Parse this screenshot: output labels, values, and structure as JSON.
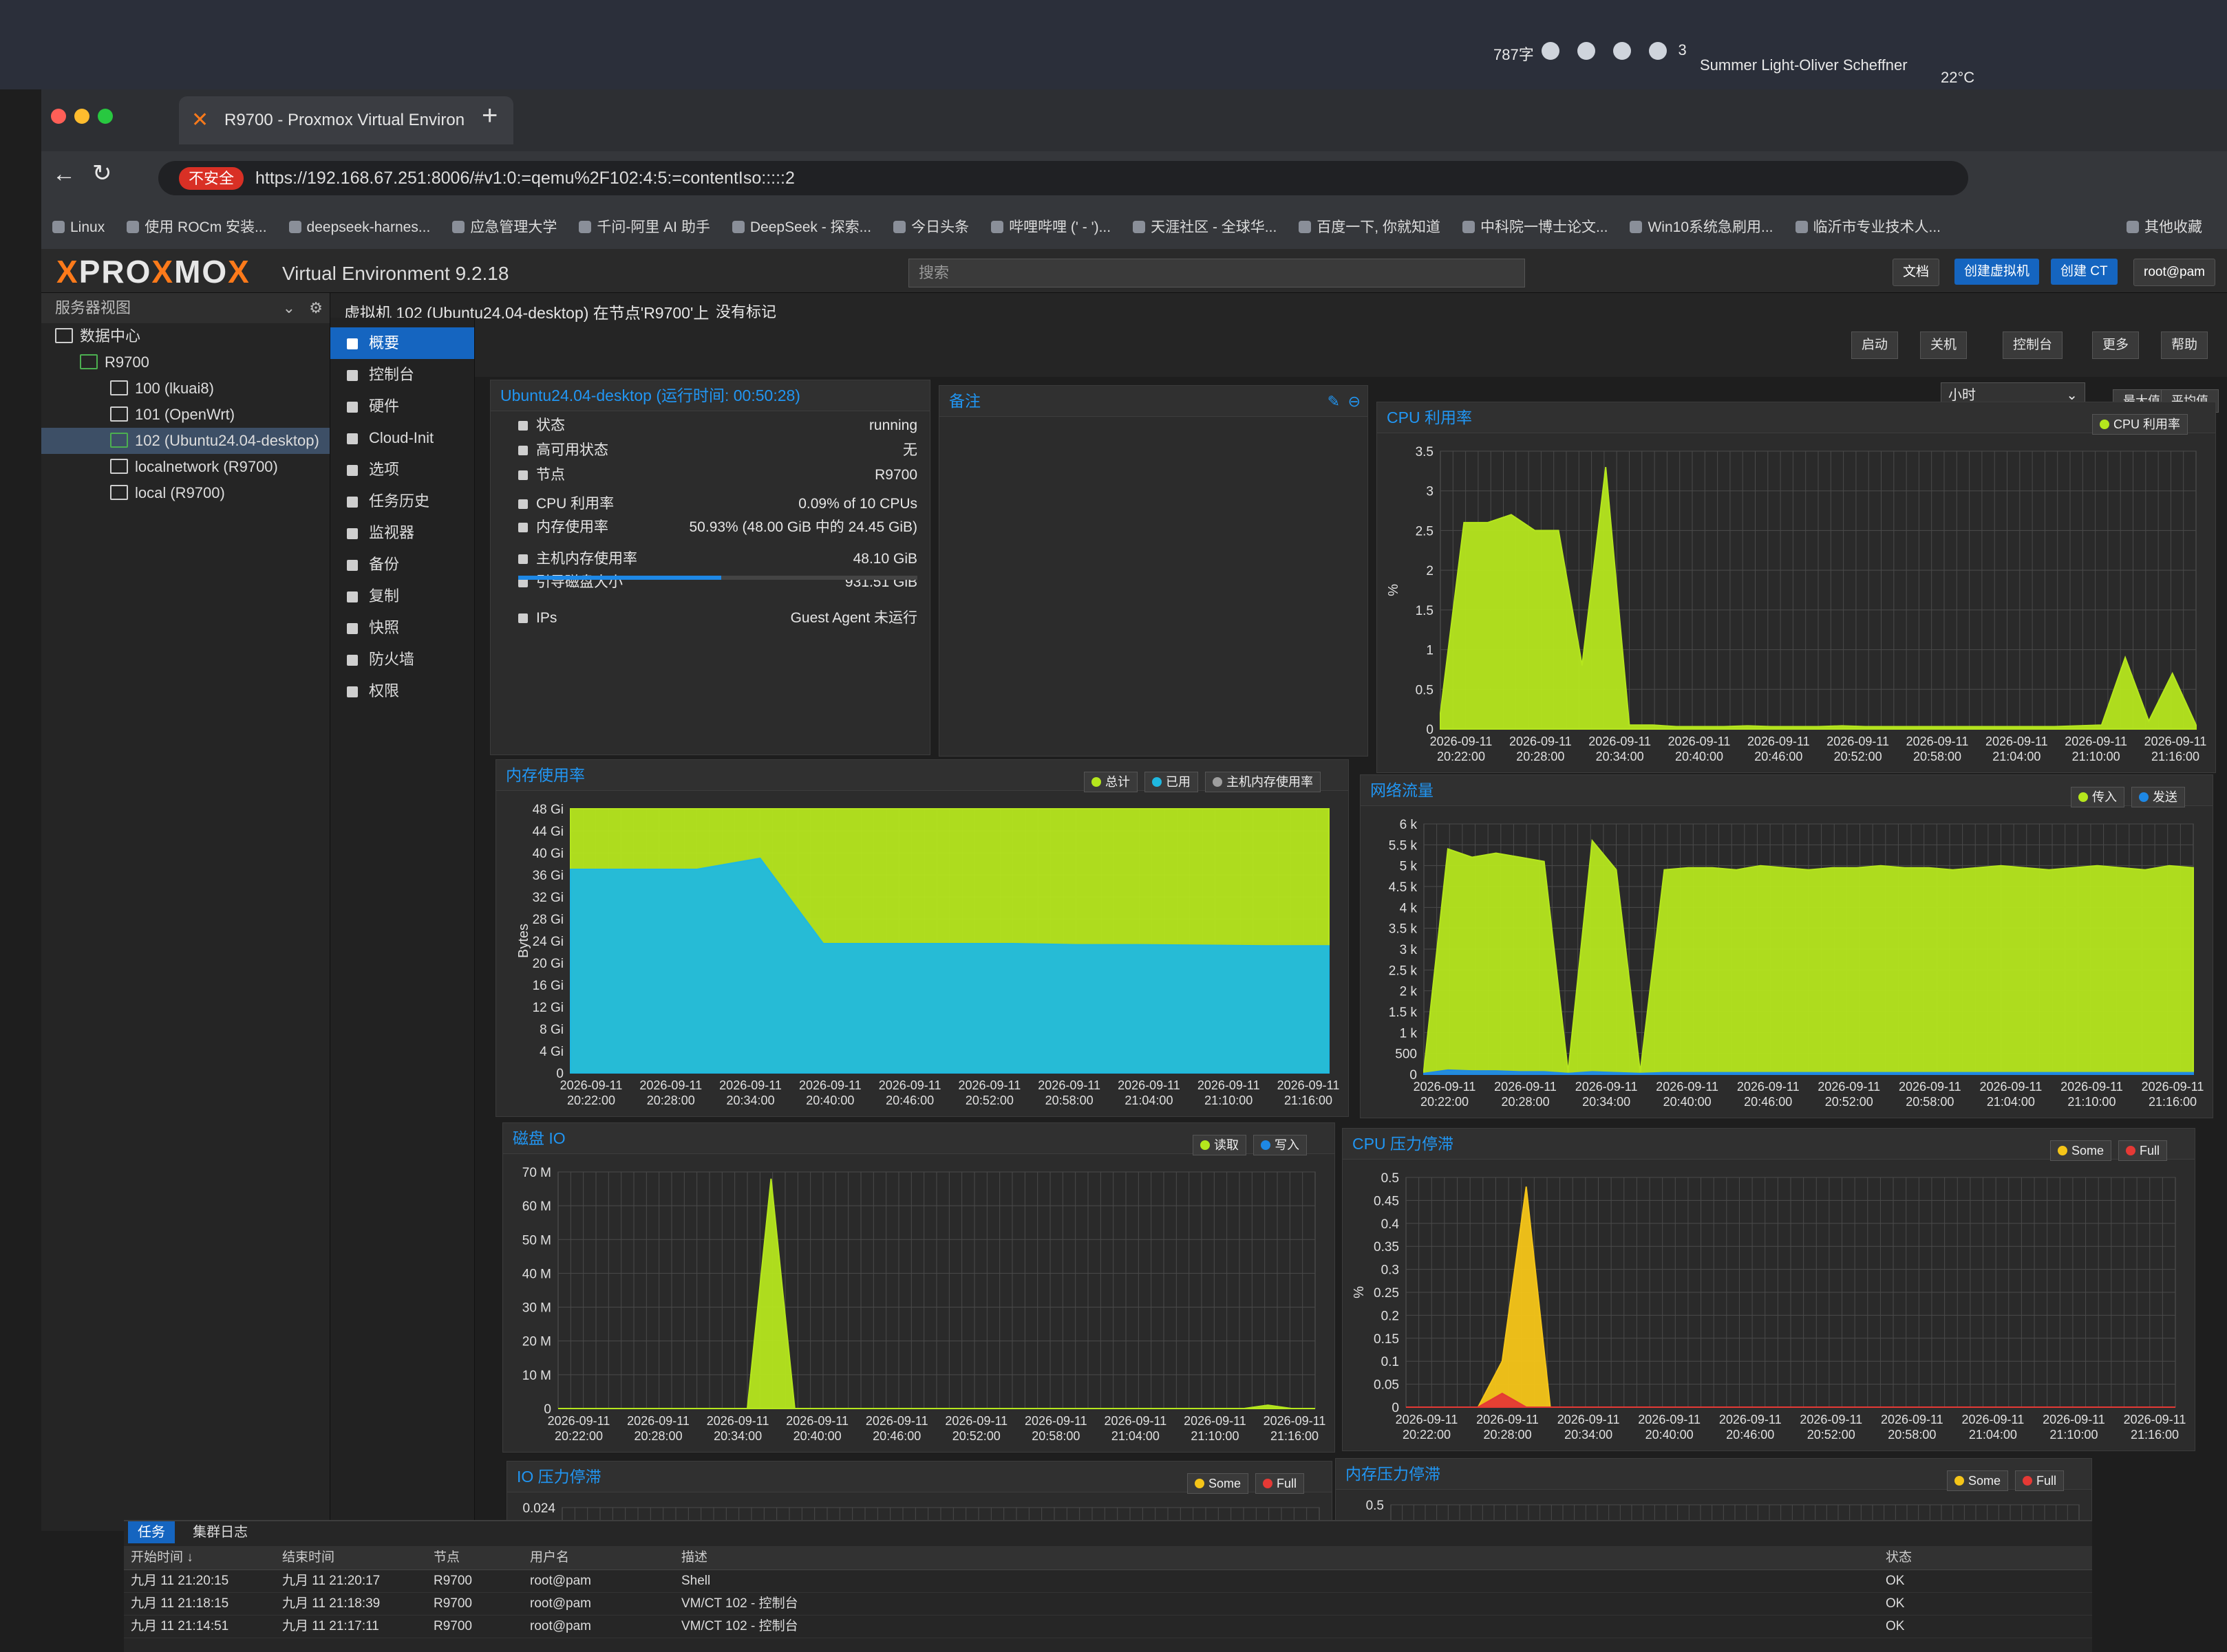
{
  "os": {
    "input_status": "787字",
    "notifications": "3",
    "music": "Summer Light-Oliver Scheffner",
    "weather": "22°C"
  },
  "browser": {
    "tab_title": "R9700 - Proxmox Virtual Environ",
    "security_label": "不安全",
    "url": "https://192.168.67.251:8006/#v1:0:=qemu%2F102:4:5:=contentIso:::::2",
    "bookmarks": [
      "Linux",
      "使用 ROCm 安装...",
      "deepseek-harnes...",
      "应急管理大学",
      "千问-阿里 AI 助手",
      "DeepSeek - 探索...",
      "今日头条",
      "哔哩哔哩 (' - ')...",
      "天涯社区 - 全球华...",
      "百度一下, 你就知道",
      "中科院一博士论文...",
      "Win10系统急刷用...",
      "临沂市专业技术人..."
    ],
    "bookmarks_other": "其他收藏"
  },
  "pve": {
    "logo_prefix": "PRO",
    "logo_x": "X",
    "logo_suffix": "MO",
    "version": "Virtual Environment 9.2.18",
    "search_placeholder": "搜索",
    "header_buttons": [
      "文档",
      "创建虚拟机",
      "创建 CT",
      "root@pam"
    ],
    "view_selector": "服务器视图",
    "tree": {
      "datacenter": "数据中心",
      "node": "R9700",
      "items": [
        "100 (lkuai8)",
        "101 (OpenWrt)",
        "102 (Ubuntu24.04-desktop)",
        "localnetwork (R9700)",
        "local (R9700)"
      ]
    },
    "vm_title": "虚拟机 102 (Ubuntu24.04-desktop) 在节点'R9700'上",
    "tags_label": "没有标记",
    "actions": [
      "启动",
      "关机",
      "控制台",
      "更多",
      "帮助"
    ],
    "timeframe": "小时",
    "agg_buttons": [
      "最大值",
      "平均值"
    ],
    "nav": [
      "概要",
      "控制台",
      "硬件",
      "Cloud-Init",
      "选项",
      "任务历史",
      "监视器",
      "备份",
      "复制",
      "快照",
      "防火墙",
      "权限"
    ]
  },
  "summary": {
    "title": "Ubuntu24.04-desktop (运行时间: 00:50:28)",
    "rows": [
      {
        "label": "状态",
        "value": "running"
      },
      {
        "label": "高可用状态",
        "value": "无"
      },
      {
        "label": "节点",
        "value": "R9700"
      },
      {
        "label": "CPU 利用率",
        "value": "0.09% of 10 CPUs"
      },
      {
        "label": "内存使用率",
        "value": "50.93% (48.00 GiB 中的 24.45 GiB)"
      },
      {
        "label": "主机内存使用率",
        "value": "48.10 GiB"
      },
      {
        "label": "引导磁盘大小",
        "value": "931.51 GiB"
      },
      {
        "label": "IPs",
        "value": "Guest Agent 未运行"
      }
    ],
    "mem_fraction": 0.5093
  },
  "notes": {
    "title": "备注"
  },
  "x_times": [
    "20:22:00",
    "20:28:00",
    "20:34:00",
    "20:40:00",
    "20:46:00",
    "20:52:00",
    "20:58:00",
    "21:04:00",
    "21:10:00",
    "21:16:00"
  ],
  "x_date": "2026-09-11",
  "chart_data": [
    {
      "id": "cpu",
      "type": "area",
      "title": "CPU 利用率",
      "ylabel": "%",
      "yticks": [
        "0",
        "0.5",
        "1",
        "1.5",
        "2",
        "2.5",
        "3",
        "3.5"
      ],
      "ylim": [
        0,
        3.5
      ],
      "series": [
        {
          "name": "CPU 利用率",
          "color": "#b5e61d",
          "values": [
            0.2,
            2.6,
            2.6,
            2.7,
            2.5,
            2.5,
            0.8,
            3.3,
            0.05,
            0.05,
            0.03,
            0.03,
            0.03,
            0.04,
            0.03,
            0.03,
            0.03,
            0.04,
            0.03,
            0.03,
            0.03,
            0.03,
            0.03,
            0.03,
            0.03,
            0.03,
            0.03,
            0.04,
            0.05,
            0.9,
            0.1,
            0.7,
            0.05
          ]
        }
      ]
    },
    {
      "id": "mem",
      "type": "area",
      "title": "内存使用率",
      "ylabel": "Bytes",
      "yticks": [
        "0",
        "4 Gi",
        "8 Gi",
        "12 Gi",
        "16 Gi",
        "20 Gi",
        "24 Gi",
        "28 Gi",
        "32 Gi",
        "36 Gi",
        "40 Gi",
        "44 Gi",
        "48 Gi"
      ],
      "ylim": [
        0,
        48
      ],
      "series": [
        {
          "name": "总计",
          "color": "#b5e61d",
          "values": [
            48,
            48,
            48,
            48,
            48,
            48,
            48,
            48,
            48,
            48,
            48,
            48,
            48
          ]
        },
        {
          "name": "已用",
          "color": "#1fb8e0",
          "values": [
            37,
            37,
            37,
            39,
            23.5,
            23.5,
            23.5,
            23.5,
            23.3,
            23.3,
            23.2,
            23.1,
            23.1
          ]
        },
        {
          "name": "主机内存使用率",
          "color": "#9e9e9e",
          "values": []
        }
      ]
    },
    {
      "id": "net",
      "type": "area",
      "title": "网络流量",
      "yticks": [
        "0",
        "500",
        "1 k",
        "1.5 k",
        "2 k",
        "2.5 k",
        "3 k",
        "3.5 k",
        "4 k",
        "4.5 k",
        "5 k",
        "5.5 k",
        "6 k"
      ],
      "ylim": [
        0,
        6000
      ],
      "series": [
        {
          "name": "传入",
          "color": "#b5e61d",
          "values": [
            100,
            5400,
            5200,
            5300,
            5200,
            5100,
            50,
            5600,
            4900,
            50,
            4900,
            4950,
            4950,
            4900,
            5000,
            4950,
            4900,
            4950,
            4950,
            5000,
            4950,
            4950,
            4900,
            4950,
            5000,
            4950,
            4900,
            4950,
            5000,
            4950,
            4900,
            5000,
            4950
          ]
        },
        {
          "name": "发送",
          "color": "#1e88e5",
          "values": [
            20,
            100,
            80,
            80,
            60,
            60,
            20,
            60,
            40,
            20,
            40,
            40,
            40,
            40,
            40,
            40,
            40,
            40,
            40,
            40,
            40,
            40,
            40,
            40,
            40,
            40,
            40,
            40,
            40,
            40,
            40,
            40,
            40
          ]
        }
      ]
    },
    {
      "id": "disk",
      "type": "area",
      "title": "磁盘 IO",
      "yticks": [
        "0",
        "10 M",
        "20 M",
        "30 M",
        "40 M",
        "50 M",
        "60 M",
        "70 M"
      ],
      "ylim": [
        0,
        70
      ],
      "series": [
        {
          "name": "读取",
          "color": "#b5e61d",
          "values": [
            0,
            0,
            0,
            0,
            0,
            0,
            0,
            0,
            0,
            68,
            0,
            0,
            0,
            0,
            0,
            0,
            0,
            0,
            0,
            0,
            0,
            0,
            0,
            0,
            0,
            0,
            0,
            0,
            0,
            0,
            1,
            0,
            0
          ]
        },
        {
          "name": "写入",
          "color": "#1e88e5",
          "values": []
        }
      ]
    },
    {
      "id": "cpupress",
      "type": "area",
      "title": "CPU 压力停滞",
      "ylabel": "%",
      "yticks": [
        "0",
        "0.05",
        "0.1",
        "0.15",
        "0.2",
        "0.25",
        "0.3",
        "0.35",
        "0.4",
        "0.45",
        "0.5"
      ],
      "ylim": [
        0,
        0.5
      ],
      "series": [
        {
          "name": "Some",
          "color": "#f5c518",
          "values": [
            0,
            0,
            0,
            0,
            0.1,
            0.48,
            0,
            0,
            0,
            0,
            0,
            0,
            0,
            0,
            0,
            0,
            0,
            0,
            0,
            0,
            0,
            0,
            0,
            0,
            0,
            0,
            0,
            0,
            0,
            0,
            0,
            0,
            0
          ]
        },
        {
          "name": "Full",
          "color": "#e53935",
          "values": [
            0,
            0,
            0,
            0,
            0.03,
            0,
            0,
            0,
            0,
            0,
            0,
            0,
            0,
            0,
            0,
            0,
            0,
            0,
            0,
            0,
            0,
            0,
            0,
            0,
            0,
            0,
            0,
            0,
            0,
            0,
            0,
            0,
            0
          ]
        }
      ]
    },
    {
      "id": "iopress",
      "type": "area",
      "title": "IO 压力停滞",
      "yticks": [
        "0.024"
      ],
      "series": [
        {
          "name": "Some",
          "color": "#f5c518",
          "values": []
        },
        {
          "name": "Full",
          "color": "#e53935",
          "values": []
        }
      ]
    },
    {
      "id": "mempress",
      "type": "area",
      "title": "内存压力停滞",
      "yticks": [
        "0.5"
      ],
      "series": [
        {
          "name": "Some",
          "color": "#f5c518",
          "values": []
        },
        {
          "name": "Full",
          "color": "#e53935",
          "values": []
        }
      ]
    }
  ],
  "tasks": {
    "tabs": [
      "任务",
      "集群日志"
    ],
    "columns": [
      "开始时间 ↓",
      "结束时间",
      "节点",
      "用户名",
      "描述",
      "状态"
    ],
    "rows": [
      [
        "九月 11 21:20:15",
        "九月 11 21:20:17",
        "R9700",
        "root@pam",
        "Shell",
        "OK"
      ],
      [
        "九月 11 21:18:15",
        "九月 11 21:18:39",
        "R9700",
        "root@pam",
        "VM/CT 102 - 控制台",
        "OK"
      ],
      [
        "九月 11 21:14:51",
        "九月 11 21:17:11",
        "R9700",
        "root@pam",
        "VM/CT 102 - 控制台",
        "OK"
      ]
    ]
  }
}
